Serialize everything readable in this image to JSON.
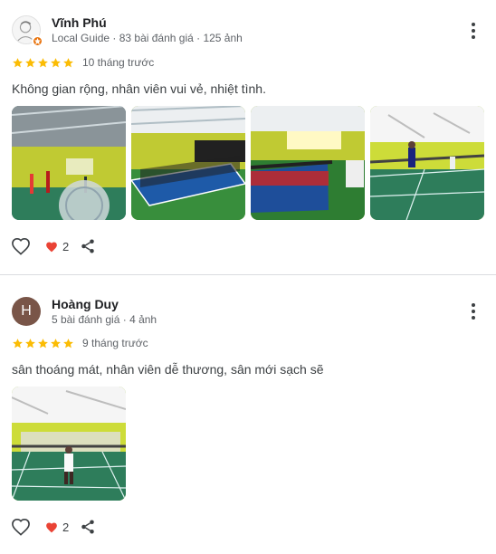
{
  "reviews": [
    {
      "author": "Vĩnh Phú",
      "meta": "Local Guide · 83 bài đánh giá · 125 ảnh",
      "rating": 5,
      "time": "10 tháng trước",
      "text": "Không gian rộng, nhân viên vui vẻ, nhiệt tình.",
      "photos": 4,
      "reactions": "2",
      "icons": [
        "heart-outline-icon",
        "heart-filled-icon",
        "share-icon",
        "more-vert-icon"
      ]
    },
    {
      "author": "Hoàng Duy",
      "avatar_letter": "H",
      "meta": "5 bài đánh giá · 4 ảnh",
      "rating": 5,
      "time": "9 tháng trước",
      "text": "sân thoáng mát, nhân viên dễ thương, sân mới sạch sẽ",
      "photos": 1,
      "reactions": "2"
    }
  ],
  "colors": {
    "star": "#fbbc04",
    "heart": "#ea4335",
    "avatar_h": "#795548",
    "court_green": "#2e7d5b",
    "wall_yellow": "#d4e157"
  }
}
